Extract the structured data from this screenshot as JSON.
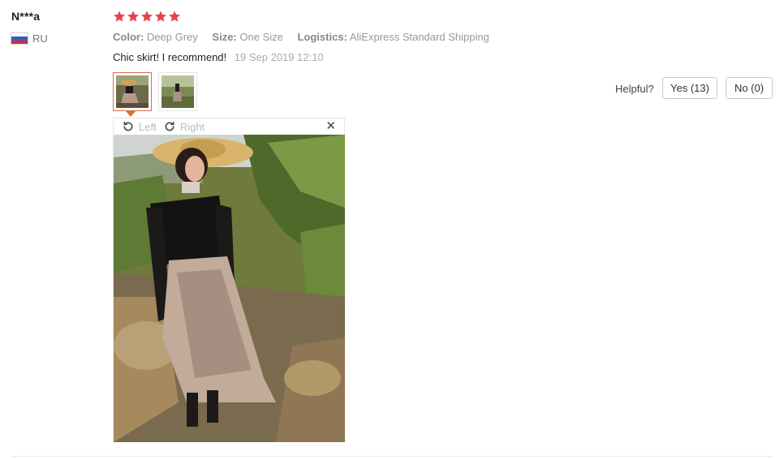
{
  "user": {
    "name": "N***a",
    "country": "RU",
    "flag_icon": "russia-flag-icon"
  },
  "rating": {
    "stars": 5,
    "max": 5,
    "color": "#e2444f"
  },
  "meta": {
    "color_label": "Color:",
    "color_value": "Deep Grey",
    "size_label": "Size:",
    "size_value": "One Size",
    "logistics_label": "Logistics:",
    "logistics_value": "AliExpress Standard Shipping"
  },
  "review": {
    "text": "Chic skirt! I recommend!",
    "date": "19 Sep 2019 12:10"
  },
  "thumbnails": [
    {
      "name": "review-thumbnail-1",
      "selected": true
    },
    {
      "name": "review-thumbnail-2",
      "selected": false
    }
  ],
  "helpful": {
    "label": "Helpful?",
    "yes_label": "Yes (13)",
    "no_label": "No (0)"
  },
  "viewer": {
    "rotate_left_label": "Left",
    "rotate_right_label": "Right",
    "close_glyph": "✕"
  },
  "colors": {
    "accent": "#e06a3b",
    "muted": "#999999"
  }
}
